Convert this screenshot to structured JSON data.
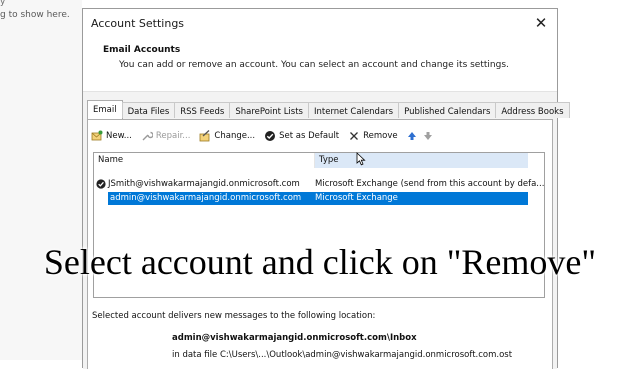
{
  "background": {
    "hint_text": "g to show here.",
    "top_fragment": "y"
  },
  "dialog": {
    "title": "Account Settings",
    "header": {
      "title": "Email Accounts",
      "subtitle": "You can add or remove an account. You can select an account and change its settings."
    },
    "tabs": [
      {
        "label": "Email",
        "active": true
      },
      {
        "label": "Data Files"
      },
      {
        "label": "RSS Feeds"
      },
      {
        "label": "SharePoint Lists"
      },
      {
        "label": "Internet Calendars"
      },
      {
        "label": "Published Calendars"
      },
      {
        "label": "Address Books"
      }
    ],
    "toolbar": {
      "new_label": "New...",
      "repair_label": "Repair...",
      "change_label": "Change...",
      "default_label": "Set as Default",
      "remove_label": "Remove"
    },
    "list": {
      "columns": [
        "Name",
        "Type"
      ],
      "rows": [
        {
          "name": "JSmith@vishwakarmajangid.onmicrosoft.com",
          "type": "Microsoft Exchange (send from this account by defa...",
          "default": true
        },
        {
          "name": "admin@vishwakarmajangid.onmicrosoft.com",
          "type": "Microsoft Exchange",
          "selected": true
        }
      ]
    },
    "delivery": {
      "label": "Selected account delivers new messages to the following location:",
      "inbox": "admin@vishwakarmajangid.onmicrosoft.com\\Inbox",
      "data_file": "in data file C:\\Users\\...\\Outlook\\admin@vishwakarmajangid.onmicrosoft.com.ost"
    }
  },
  "caption": "Select account and click on \"Remove\"",
  "colors": {
    "selection": "#0078d7",
    "header_highlight": "#dbe8f7"
  }
}
